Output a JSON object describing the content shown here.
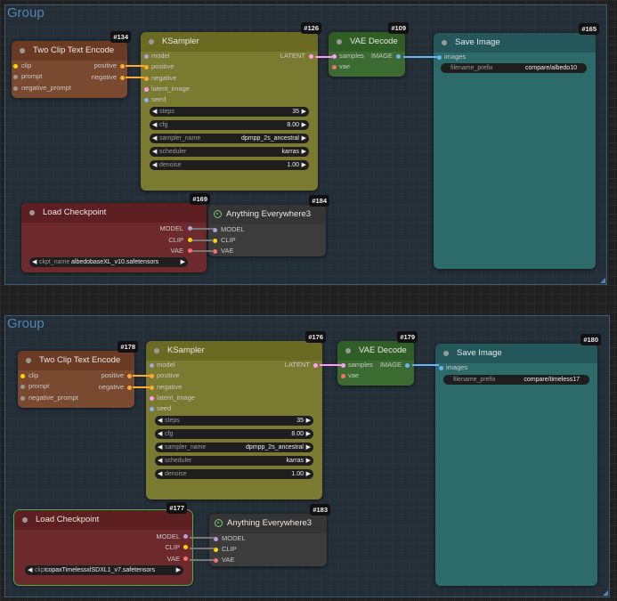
{
  "groups": [
    {
      "title": "Group"
    },
    {
      "title": "Group"
    }
  ],
  "g1": {
    "tcte": {
      "id": "#134",
      "title": "Two Clip Text Encode",
      "inputs": [
        "clip",
        "prompt",
        "negative_prompt"
      ],
      "outputs": [
        "positive",
        "negative"
      ]
    },
    "ks": {
      "id": "#126",
      "title": "KSampler",
      "inputs": [
        "model",
        "positive",
        "negative",
        "latent_image",
        "seed"
      ],
      "output": "LATENT",
      "widgets": [
        {
          "label": "steps",
          "value": "35"
        },
        {
          "label": "cfg",
          "value": "8.00"
        },
        {
          "label": "sampler_name",
          "value": "dpmpp_2s_ancestral"
        },
        {
          "label": "scheduler",
          "value": "karras"
        },
        {
          "label": "denoise",
          "value": "1.00"
        }
      ]
    },
    "vae": {
      "id": "#109",
      "title": "VAE Decode",
      "inputs": [
        "samples",
        "vae"
      ],
      "output": "IMAGE"
    },
    "save": {
      "id": "#165",
      "title": "Save Image",
      "input": "images",
      "widget": {
        "label": "filename_prefix",
        "value": "compare/albedo10"
      }
    },
    "ckpt": {
      "id": "#169",
      "title": "Load Checkpoint",
      "outputs": [
        "MODEL",
        "CLIP",
        "VAE"
      ],
      "widget": {
        "label": "ckpt_name",
        "value": "albedobaseXL_v10.safetensors"
      }
    },
    "ae": {
      "id": "#184",
      "title": "Anything Everywhere3",
      "inputs": [
        "MODEL",
        "CLIP",
        "VAE"
      ]
    }
  },
  "g2": {
    "tcte": {
      "id": "#178",
      "title": "Two Clip Text Encode",
      "inputs": [
        "clip",
        "prompt",
        "negative_prompt"
      ],
      "outputs": [
        "positive",
        "negative"
      ]
    },
    "ks": {
      "id": "#176",
      "title": "KSampler",
      "inputs": [
        "model",
        "positive",
        "negative",
        "latent_image",
        "seed"
      ],
      "output": "LATENT",
      "widgets": [
        {
          "label": "steps",
          "value": "35"
        },
        {
          "label": "cfg",
          "value": "8.00"
        },
        {
          "label": "sampler_name",
          "value": "dpmpp_2s_ancestral"
        },
        {
          "label": "scheduler",
          "value": "karras"
        },
        {
          "label": "denoise",
          "value": "1.00"
        }
      ]
    },
    "vae": {
      "id": "#179",
      "title": "VAE Decode",
      "inputs": [
        "samples",
        "vae"
      ],
      "output": "IMAGE"
    },
    "save": {
      "id": "#180",
      "title": "Save Image",
      "input": "images",
      "widget": {
        "label": "filename_prefix",
        "value": "compare/timeless17"
      }
    },
    "ckpt": {
      "id": "#177",
      "title": "Load Checkpoint",
      "outputs": [
        "MODEL",
        "CLIP",
        "VAE"
      ],
      "widget": {
        "label": "ckpt",
        "value": "copaxTimelessxlSDXL1_v7.safetensors"
      }
    },
    "ae": {
      "id": "#183",
      "title": "Anything Everywhere3",
      "inputs": [
        "MODEL",
        "CLIP",
        "VAE"
      ]
    }
  },
  "glyphs": {
    "left": "◀",
    "right": "▶"
  },
  "colors": {
    "tcte_header": "#6b3a22",
    "tcte_body": "#7a4a30",
    "ks_header": "#6a6a22",
    "ks_body": "#7a7a30",
    "vae_header": "#2f5f24",
    "vae_body": "#3b6b30",
    "save_header": "#23575a",
    "save_body": "#2d6a6a",
    "ckpt_header": "#5d1f22",
    "ckpt_body": "#6d2a2c",
    "ae_header": "#353535",
    "ae_body": "#3c3c3c",
    "clip": "#ffd500",
    "model": "#b39ddb",
    "vae": "#ff6e6e",
    "latent": "#ff9cf9",
    "image": "#64b5f6",
    "cond": "#ffa931",
    "selected": "#4caf50"
  }
}
